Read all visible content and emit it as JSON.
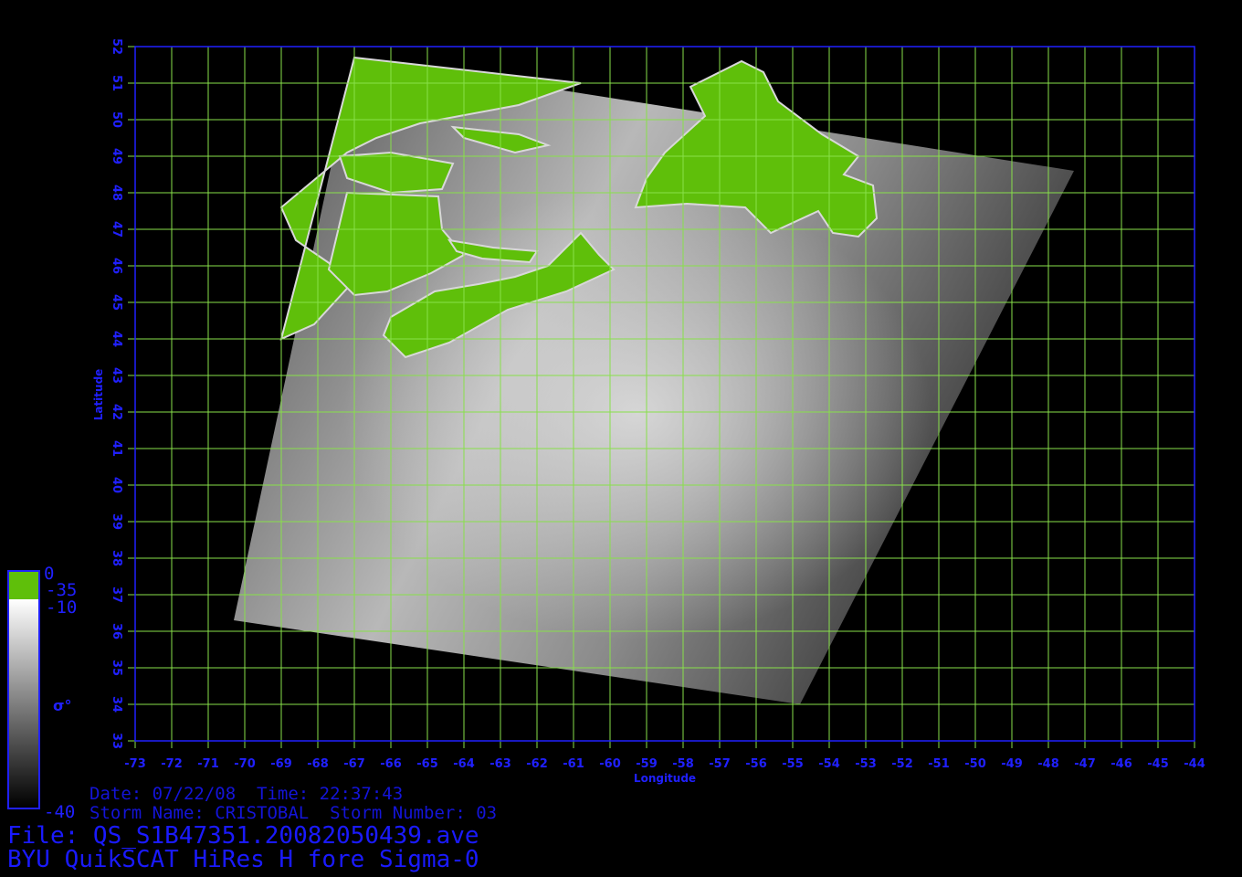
{
  "map": {
    "x_axis_label": "Longitude",
    "y_axis_label": "Latitude",
    "lon_range": [
      -73,
      -44
    ],
    "lat_range": [
      33,
      52
    ],
    "lon_ticks": [
      "-73",
      "-72",
      "-71",
      "-70",
      "-69",
      "-68",
      "-67",
      "-66",
      "-65",
      "-64",
      "-63",
      "-62",
      "-61",
      "-60",
      "-59",
      "-58",
      "-57",
      "-56",
      "-55",
      "-54",
      "-53",
      "-52",
      "-51",
      "-50",
      "-49",
      "-48",
      "-47",
      "-46",
      "-45",
      "-44"
    ],
    "lat_ticks": [
      "33",
      "34",
      "35",
      "36",
      "37",
      "38",
      "39",
      "40",
      "41",
      "42",
      "43",
      "44",
      "45",
      "46",
      "47",
      "48",
      "49",
      "50",
      "51",
      "52"
    ],
    "grid_color": "#88e04a",
    "frame_color": "#2020ff",
    "land_color": "#5fbf0a",
    "swath_corners_lonlat": [
      [
        -67,
        51.7
      ],
      [
        -47.3,
        48.6
      ],
      [
        -54.8,
        34.0
      ],
      [
        -70.3,
        36.3
      ]
    ],
    "land_regions": [
      {
        "name": "mainland",
        "outline": [
          [
            -67,
            51.7
          ],
          [
            -60.8,
            51.0
          ],
          [
            -62.5,
            50.4
          ],
          [
            -65.2,
            49.9
          ],
          [
            -66.4,
            49.5
          ],
          [
            -67.2,
            49.1
          ],
          [
            -67.8,
            48.6
          ],
          [
            -69.0,
            47.6
          ],
          [
            -68.6,
            46.7
          ],
          [
            -67.0,
            45.6
          ],
          [
            -68.1,
            44.4
          ],
          [
            -69.0,
            44.0
          ]
        ]
      },
      {
        "name": "gaspe",
        "outline": [
          [
            -67.4,
            49.0
          ],
          [
            -66.0,
            49.1
          ],
          [
            -64.3,
            48.8
          ],
          [
            -64.6,
            48.1
          ],
          [
            -66.0,
            48.0
          ],
          [
            -67.2,
            48.4
          ]
        ]
      },
      {
        "name": "new-brunswick",
        "outline": [
          [
            -67.2,
            48.0
          ],
          [
            -64.7,
            47.9
          ],
          [
            -64.6,
            47.0
          ],
          [
            -64.0,
            46.3
          ],
          [
            -64.9,
            45.8
          ],
          [
            -66.1,
            45.3
          ],
          [
            -67.0,
            45.2
          ],
          [
            -67.7,
            45.9
          ]
        ]
      },
      {
        "name": "nova-scotia",
        "outline": [
          [
            -66.0,
            44.6
          ],
          [
            -64.8,
            45.3
          ],
          [
            -63.6,
            45.5
          ],
          [
            -62.6,
            45.7
          ],
          [
            -61.7,
            46.0
          ],
          [
            -60.8,
            46.9
          ],
          [
            -60.3,
            46.3
          ],
          [
            -59.9,
            45.9
          ],
          [
            -61.2,
            45.3
          ],
          [
            -62.8,
            44.8
          ],
          [
            -64.4,
            43.9
          ],
          [
            -65.6,
            43.5
          ],
          [
            -66.2,
            44.1
          ]
        ]
      },
      {
        "name": "pei",
        "outline": [
          [
            -64.4,
            46.7
          ],
          [
            -63.2,
            46.5
          ],
          [
            -62.0,
            46.4
          ],
          [
            -62.2,
            46.1
          ],
          [
            -63.5,
            46.2
          ],
          [
            -64.2,
            46.4
          ]
        ]
      },
      {
        "name": "anticosti",
        "outline": [
          [
            -64.3,
            49.8
          ],
          [
            -62.5,
            49.6
          ],
          [
            -61.7,
            49.3
          ],
          [
            -62.6,
            49.1
          ],
          [
            -64.0,
            49.5
          ]
        ]
      },
      {
        "name": "newfoundland",
        "outline": [
          [
            -57.8,
            50.9
          ],
          [
            -56.4,
            51.6
          ],
          [
            -55.8,
            51.3
          ],
          [
            -55.4,
            50.5
          ],
          [
            -54.2,
            49.6
          ],
          [
            -53.2,
            49.0
          ],
          [
            -53.6,
            48.5
          ],
          [
            -52.8,
            48.2
          ],
          [
            -52.7,
            47.3
          ],
          [
            -53.2,
            46.8
          ],
          [
            -53.9,
            46.9
          ],
          [
            -54.3,
            47.5
          ],
          [
            -55.6,
            46.9
          ],
          [
            -56.3,
            47.6
          ],
          [
            -57.9,
            47.7
          ],
          [
            -59.3,
            47.6
          ],
          [
            -59.0,
            48.4
          ],
          [
            -58.5,
            49.1
          ],
          [
            -57.4,
            50.1
          ]
        ]
      }
    ],
    "colorbar": {
      "land_top_label": "0",
      "land_bottom_label": "-35",
      "sea_top_label": "-10",
      "sea_bottom_label": "-40",
      "symbol_label": "σ°"
    }
  },
  "footer": {
    "date_line": "Date: 07/22/08  Time: 22:37:43",
    "storm_line": "Storm Name: CRISTOBAL  Storm Number: 03",
    "file_line": "File: QS_S1B47351.20082050439.ave",
    "title_line": "BYU QuikSCAT HiRes H fore Sigma-0"
  }
}
